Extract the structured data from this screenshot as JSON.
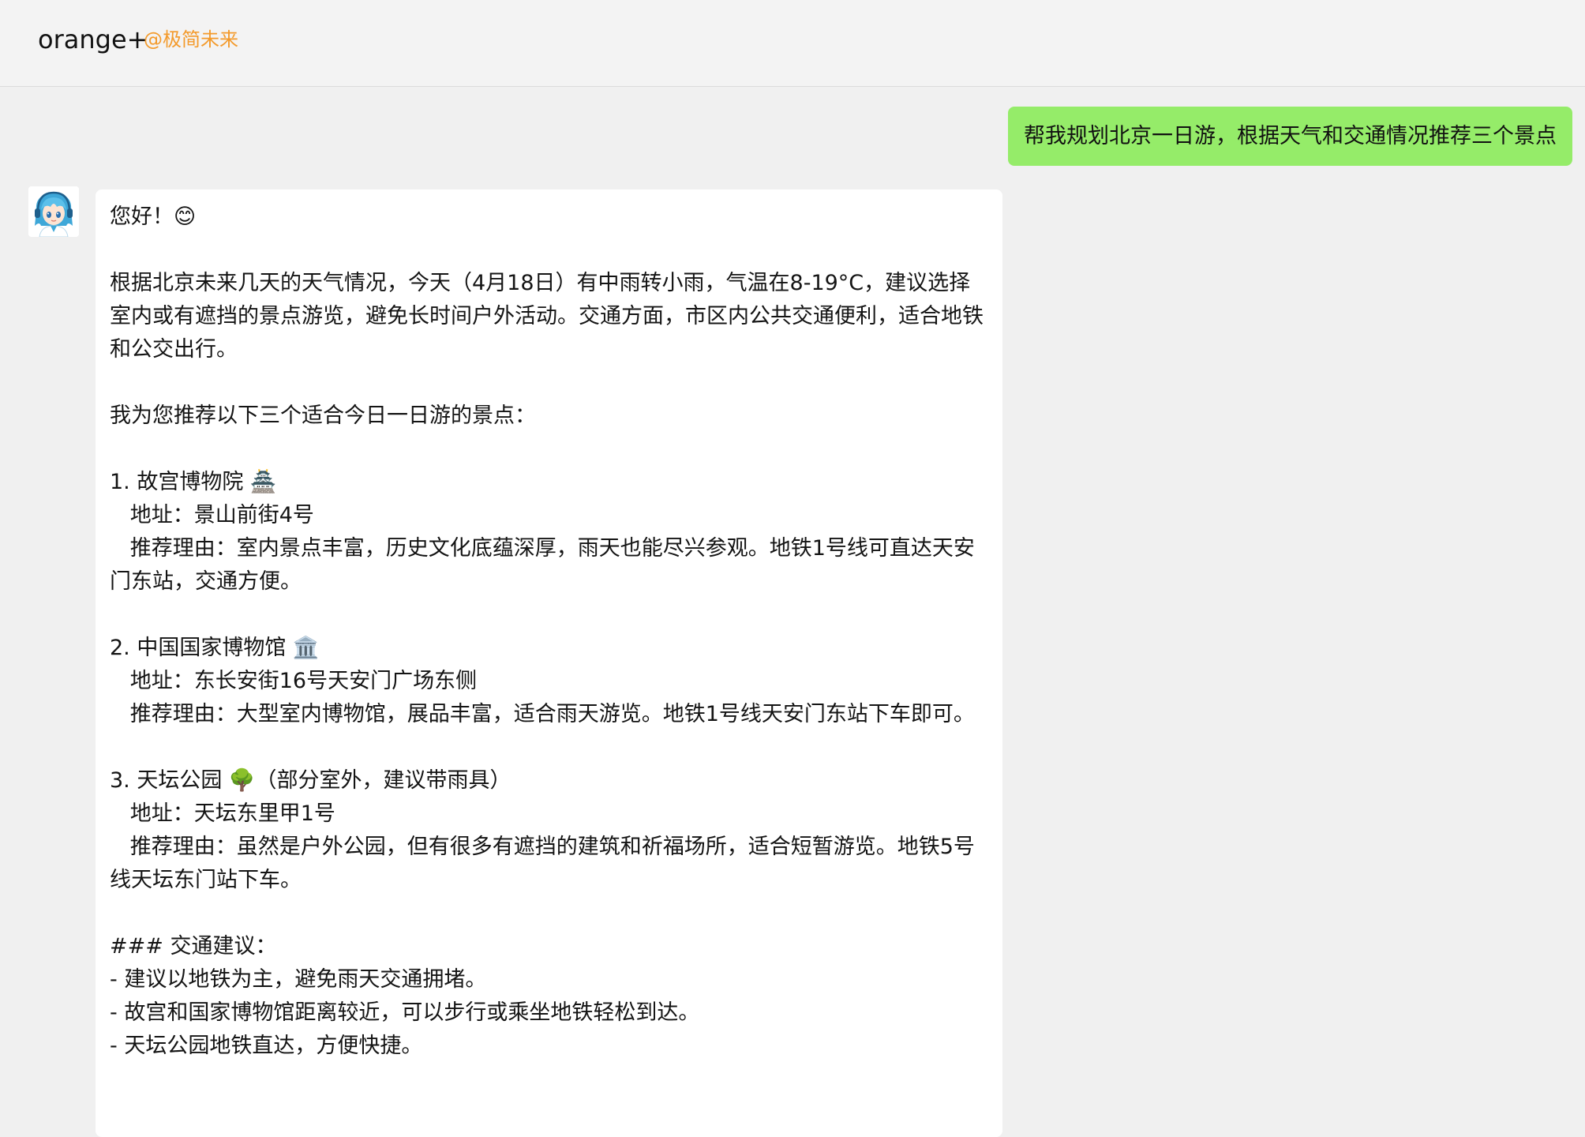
{
  "header": {
    "app_name": "orange+",
    "org": "@极简未来"
  },
  "conversation": {
    "user_message": "帮我规划北京一日游，根据天气和交通情况推荐三个景点",
    "assistant_message": "您好！😊\n\n根据北京未来几天的天气情况，今天（4月18日）有中雨转小雨，气温在8-19°C，建议选择室内或有遮挡的景点游览，避免长时间户外活动。交通方面，市区内公共交通便利，适合地铁和公交出行。\n\n我为您推荐以下三个适合今日一日游的景点：\n\n1. 故宫博物院 🏯\n   地址：景山前街4号\n   推荐理由：室内景点丰富，历史文化底蕴深厚，雨天也能尽兴参观。地铁1号线可直达天安门东站，交通方便。\n\n2. 中国国家博物馆 🏛️\n   地址：东长安街16号天安门广场东侧\n   推荐理由：大型室内博物馆，展品丰富，适合雨天游览。地铁1号线天安门东站下车即可。\n\n3. 天坛公园 🌳（部分室外，建议带雨具）\n   地址：天坛东里甲1号\n   推荐理由：虽然是户外公园，但有很多有遮挡的建筑和祈福场所，适合短暂游览。地铁5号线天坛东门站下车。\n\n### 交通建议：\n- 建议以地铁为主，避免雨天交通拥堵。\n- 故宫和国家博物馆距离较近，可以步行或乘坐地铁轻松到达。\n- 天坛公园地铁直达，方便快捷。"
  },
  "icons": {
    "assistant_avatar": "anime-girl-avatar-icon"
  },
  "colors": {
    "user_bubble": "#95ec69",
    "org_accent": "#f39a2b",
    "background": "#f0f0f0"
  }
}
